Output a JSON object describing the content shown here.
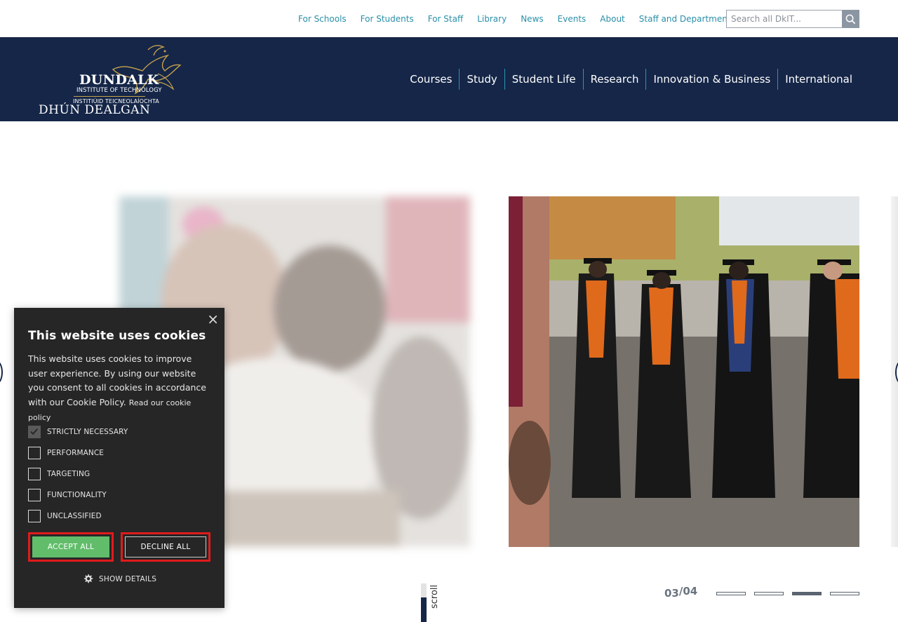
{
  "toplinks": [
    "For Schools",
    "For Students",
    "For Staff",
    "Library",
    "News",
    "Events",
    "About",
    "Staff and Departments"
  ],
  "search": {
    "placeholder": "Search all DkIT..."
  },
  "logo": {
    "line1": "DUNDALK",
    "line2": "INSTITUTE OF TECHNOLOGY",
    "line3": "INSTITIÚID TEICNEOLAÍOCHTA",
    "line4": "DHÚN DEALGAN"
  },
  "nav": [
    "Courses",
    "Study",
    "Student Life",
    "Research",
    "Innovation & Business",
    "International"
  ],
  "carousel": {
    "current": "03",
    "total": "/04",
    "active_index": 3,
    "pages": 4,
    "scroll_label": "scroll"
  },
  "cookie": {
    "title": "This website uses cookies",
    "body": "This website uses cookies to improve user experience. By using our website you consent to all cookies in accordance with our Cookie Policy.",
    "policy_link": "Read our cookie policy",
    "options": [
      {
        "label": "STRICTLY NECESSARY",
        "checked": true
      },
      {
        "label": "PERFORMANCE",
        "checked": false
      },
      {
        "label": "TARGETING",
        "checked": false
      },
      {
        "label": "FUNCTIONALITY",
        "checked": false
      },
      {
        "label": "UNCLASSIFIED",
        "checked": false
      }
    ],
    "accept_label": "ACCEPT ALL",
    "decline_label": "DECLINE ALL",
    "details_label": "SHOW DETAILS",
    "close_symbol": "×"
  },
  "colors": {
    "navy": "#152648",
    "teal_link": "#2a8fa8",
    "accept_green": "#62bd6b",
    "highlight_red": "#e01b1b",
    "dialog_bg": "#262626"
  }
}
